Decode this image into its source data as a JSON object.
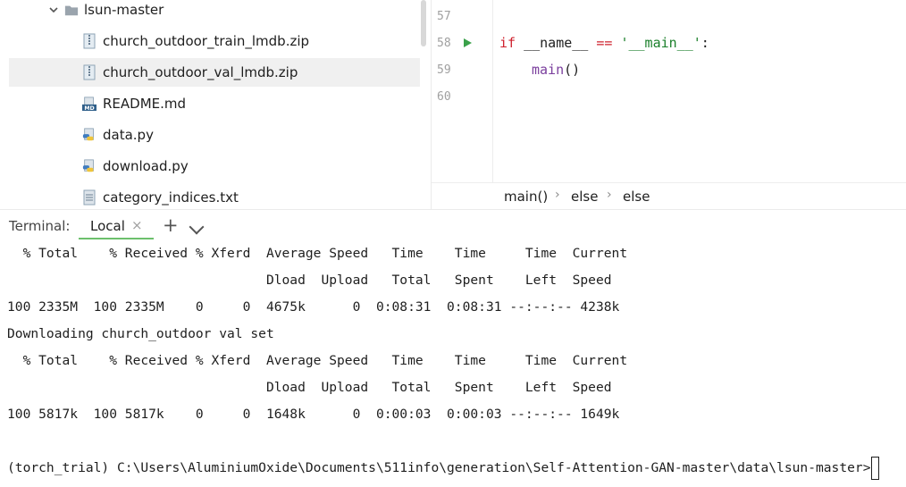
{
  "project_tree": {
    "folder": {
      "label": "lsun-master",
      "expanded": true
    },
    "items": [
      {
        "label": "church_outdoor_train_lmdb.zip",
        "icon": "zip-archive-icon",
        "selected": false
      },
      {
        "label": "church_outdoor_val_lmdb.zip",
        "icon": "zip-archive-icon",
        "selected": true
      },
      {
        "label": "README.md",
        "icon": "markdown-file-icon",
        "selected": false
      },
      {
        "label": "data.py",
        "icon": "python-file-icon",
        "selected": false
      },
      {
        "label": "download.py",
        "icon": "python-file-icon",
        "selected": false
      },
      {
        "label": "category_indices.txt",
        "icon": "text-file-icon",
        "selected": false
      }
    ]
  },
  "editor": {
    "line_numbers": [
      "57",
      "58",
      "59",
      "60"
    ],
    "code": {
      "line58": {
        "kw": "if",
        "name": " __name__ ",
        "op": "==",
        "str": " '__main__'",
        "colon": ":"
      },
      "line59": {
        "fn": "main",
        "parens": "()"
      }
    },
    "breadcrumbs": [
      "main()",
      "else",
      "else"
    ],
    "breadcrumb_sep": "›"
  },
  "terminal": {
    "title": "Terminal:",
    "tab_label": "Local",
    "close_glyph": "×",
    "add_glyph": "+",
    "lines": [
      "  % Total    % Received % Xferd  Average Speed   Time    Time     Time  Current",
      "                                 Dload  Upload   Total   Spent    Left  Speed",
      "100 2335M  100 2335M    0     0  4675k      0  0:08:31  0:08:31 --:--:-- 4238k",
      "Downloading church_outdoor val set",
      "  % Total    % Received % Xferd  Average Speed   Time    Time     Time  Current",
      "                                 Dload  Upload   Total   Spent    Left  Speed",
      "100 5817k  100 5817k    0     0  1648k      0  0:00:03  0:00:03 --:--:-- 1649k",
      "",
      "(torch_trial) C:\\Users\\AluminiumOxide\\Documents\\511info\\generation\\Self-Attention-GAN-master\\data\\lsun-master>"
    ]
  },
  "colors": {
    "keyword": "#cf222e",
    "string": "#1a7f2a",
    "function": "#7a3e9d",
    "run_arrow": "#3aa14a",
    "tab_underline": "#6cc06c",
    "selection": "#f0f0f0"
  }
}
